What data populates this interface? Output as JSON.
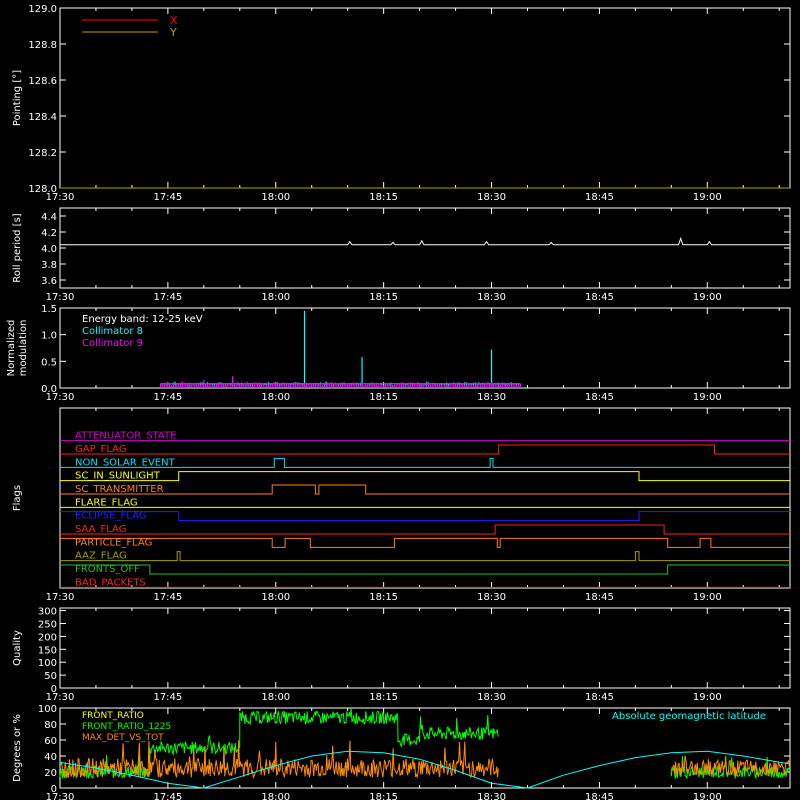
{
  "time_axis": {
    "tick_labels": [
      "17:30",
      "17:45",
      "18:00",
      "18:15",
      "18:30",
      "18:45",
      "19:00"
    ],
    "tick_minutes": [
      0,
      15,
      30,
      45,
      60,
      75,
      90
    ],
    "range_minutes": [
      0,
      101.5
    ]
  },
  "chart_data": [
    {
      "id": "pointing",
      "type": "line",
      "ylabel": "Pointing [°]",
      "ylim": [
        128.0,
        129.0
      ],
      "y_ticks": [
        "128.0",
        "128.2",
        "128.4",
        "128.6",
        "128.8",
        "129.0"
      ],
      "y_tick_values": [
        128.0,
        128.2,
        128.4,
        128.6,
        128.8,
        129.0
      ],
      "legend": [
        {
          "name": "X",
          "color": "#ff0000"
        },
        {
          "name": "Y",
          "color": "#b8a000"
        }
      ],
      "series": [
        {
          "name": "X",
          "color": "#ff0000",
          "x": [
            0,
            101.5
          ],
          "y": [
            128.0,
            128.0
          ]
        },
        {
          "name": "Y",
          "color": "#b8a000",
          "x": [
            0,
            101.5
          ],
          "y": [
            128.0,
            128.0
          ]
        }
      ]
    },
    {
      "id": "roll",
      "type": "line",
      "ylabel": "Roll period [s]",
      "ylim": [
        3.5,
        4.5
      ],
      "y_ticks": [
        "3.6",
        "3.8",
        "4.0",
        "4.2",
        "4.4"
      ],
      "y_tick_values": [
        3.6,
        3.8,
        4.0,
        4.2,
        4.4
      ],
      "series": [
        {
          "name": "",
          "color": "#ffffff",
          "x": [
            0,
            40,
            40.3,
            40.6,
            46,
            46.3,
            46.6,
            50,
            50.3,
            50.6,
            59,
            59.3,
            59.6,
            68,
            68.3,
            68.6,
            86,
            86.3,
            86.6,
            90,
            90.3,
            90.6,
            101.5
          ],
          "y": [
            4.04,
            4.04,
            4.08,
            4.04,
            4.04,
            4.07,
            4.04,
            4.04,
            4.09,
            4.04,
            4.04,
            4.08,
            4.04,
            4.04,
            4.07,
            4.04,
            4.04,
            4.12,
            4.04,
            4.04,
            4.08,
            4.04,
            4.04
          ]
        }
      ]
    },
    {
      "id": "modulation",
      "type": "line",
      "ylabel": "Normalized modulation",
      "ylim": [
        0,
        1.5
      ],
      "y_ticks": [
        "0.0",
        "0.5",
        "1.0",
        "1.5"
      ],
      "y_tick_values": [
        0,
        0.5,
        1.0,
        1.5
      ],
      "annotation": "Energy band: 12-25 keV",
      "legend": [
        {
          "name": "Collimator 8",
          "color": "#00ffff"
        },
        {
          "name": "Collimator 9",
          "color": "#ff00ff"
        }
      ],
      "series": [
        {
          "name": "Collimator 8",
          "color": "#00ffff",
          "x": [
            14,
            16,
            18,
            22,
            26,
            28,
            32,
            34,
            36,
            37,
            38,
            42,
            46,
            50,
            51,
            52,
            54,
            58,
            60,
            61,
            62,
            64
          ],
          "y": [
            0.08,
            0.12,
            0.08,
            0.1,
            0.09,
            0.08,
            0.07,
            1.45,
            0.08,
            0.12,
            0.08,
            0.58,
            0.1,
            0.08,
            0.12,
            0.09,
            0.08,
            0.08,
            0.72,
            0.1,
            0.08,
            0.07
          ]
        },
        {
          "name": "Collimator 9",
          "color": "#ff00ff",
          "x": [
            14,
            17,
            20,
            22,
            24,
            26,
            30,
            34,
            40,
            44,
            50,
            56,
            60,
            64
          ],
          "y": [
            0.08,
            0.12,
            0.15,
            0.1,
            0.22,
            0.12,
            0.1,
            0.09,
            0.08,
            0.1,
            0.08,
            0.09,
            0.1,
            0.08
          ]
        }
      ]
    },
    {
      "id": "flags",
      "type": "line",
      "ylabel": "Flags",
      "flags": [
        {
          "name": "ATTENUATOR_STATE",
          "color": "#d000d0",
          "steps": [
            [
              0,
              0
            ],
            [
              101.5,
              0
            ]
          ]
        },
        {
          "name": "GAP_FLAG",
          "color": "#ff2020",
          "steps": [
            [
              0,
              0
            ],
            [
              61,
              1
            ],
            [
              91,
              0
            ],
            [
              101.5,
              0
            ]
          ]
        },
        {
          "name": "NON_SOLAR_EVENT",
          "color": "#00e0ff",
          "steps": [
            [
              0,
              0
            ],
            [
              29.8,
              1
            ],
            [
              31.2,
              0
            ],
            [
              59.8,
              1
            ],
            [
              60.2,
              0
            ],
            [
              101.5,
              0
            ]
          ]
        },
        {
          "name": "SC_IN_SUNLIGHT",
          "color": "#ffff00",
          "steps": [
            [
              0,
              0
            ],
            [
              16.5,
              1
            ],
            [
              80.5,
              0
            ],
            [
              101.5,
              0
            ]
          ]
        },
        {
          "name": "SC_TRANSMITTER",
          "color": "#ff7f1f",
          "steps": [
            [
              0,
              0
            ],
            [
              29.5,
              1
            ],
            [
              35.5,
              0
            ],
            [
              36,
              1
            ],
            [
              42.5,
              0
            ],
            [
              101.5,
              0
            ]
          ]
        },
        {
          "name": "FLARE_FLAG",
          "color": "#ffff00",
          "steps": [
            [
              0,
              0
            ],
            [
              101.5,
              0
            ]
          ]
        },
        {
          "name": "ECLIPSE_FLAG",
          "color": "#2020ff",
          "steps": [
            [
              0,
              1
            ],
            [
              16.5,
              0
            ],
            [
              80.5,
              1
            ],
            [
              101.5,
              1
            ]
          ]
        },
        {
          "name": "SAA_FLAG",
          "color": "#ff2020",
          "steps": [
            [
              0,
              0
            ],
            [
              60.5,
              1
            ],
            [
              84,
              0
            ],
            [
              101.5,
              0
            ]
          ]
        },
        {
          "name": "PARTICLE_FLAG",
          "color": "#ff7f1f",
          "steps": [
            [
              0,
              1
            ],
            [
              29.5,
              0
            ],
            [
              31.3,
              1
            ],
            [
              34.8,
              0
            ],
            [
              46.5,
              1
            ],
            [
              60.8,
              0
            ],
            [
              61.2,
              1
            ],
            [
              84.5,
              0
            ],
            [
              89,
              1
            ],
            [
              90.5,
              0
            ],
            [
              101.5,
              0
            ]
          ]
        },
        {
          "name": "AAZ_FLAG",
          "color": "#a0a000",
          "steps": [
            [
              0,
              0
            ],
            [
              16.3,
              1
            ],
            [
              16.7,
              0
            ],
            [
              80,
              1
            ],
            [
              80.5,
              0
            ],
            [
              101.5,
              0
            ]
          ]
        },
        {
          "name": "FRONTS_OFF",
          "color": "#20c020",
          "steps": [
            [
              0,
              1
            ],
            [
              12.5,
              0
            ],
            [
              84.5,
              1
            ],
            [
              101.5,
              1
            ]
          ]
        },
        {
          "name": "BAD_PACKETS",
          "color": "#ff2020",
          "steps": [
            [
              0,
              0
            ],
            [
              101.5,
              0
            ]
          ]
        }
      ]
    },
    {
      "id": "quality",
      "type": "line",
      "ylabel": "Quality",
      "ylim": [
        0,
        310
      ],
      "y_ticks": [
        "0",
        "50",
        "100",
        "150",
        "200",
        "250",
        "300"
      ],
      "y_tick_values": [
        0,
        50,
        100,
        150,
        200,
        250,
        300
      ]
    },
    {
      "id": "front",
      "type": "line",
      "ylabel": "Degrees or %",
      "ylim": [
        0,
        100
      ],
      "y_ticks": [
        "0",
        "20",
        "40",
        "60",
        "80",
        "100"
      ],
      "y_tick_values": [
        0,
        20,
        40,
        60,
        80,
        100
      ],
      "legend": [
        {
          "name": "FRONT_RATIO",
          "color": "#ffff00"
        },
        {
          "name": "FRONT_RATIO_1225",
          "color": "#00ff00"
        },
        {
          "name": "MAX_DET_VS_TOT",
          "color": "#ff8c00"
        }
      ],
      "legend_right": {
        "name": "Absolute geomagnetic latitude",
        "color": "#00ffff"
      },
      "series": [
        {
          "name": "FRONT_RATIO_1225",
          "color": "#00ff00",
          "noise": 8,
          "x": [
            0,
            12.5,
            12.5,
            25,
            25,
            47,
            47,
            50,
            50,
            61,
            61
          ],
          "y": [
            20,
            20,
            50,
            50,
            88,
            88,
            60,
            60,
            68,
            68,
            null
          ]
        },
        {
          "name": "FRONT_RATIO_1225",
          "color": "#00ff00",
          "noise": 8,
          "x": [
            85,
            85,
            101.5
          ],
          "y": [
            20,
            20,
            20
          ]
        },
        {
          "name": "MAX_DET_VS_TOT",
          "color": "#ff8c00",
          "noise": 12,
          "x": [
            0,
            61
          ],
          "y": [
            25,
            25
          ]
        },
        {
          "name": "MAX_DET_VS_TOT",
          "color": "#ff8c00",
          "noise": 10,
          "x": [
            85,
            101.5
          ],
          "y": [
            25,
            25
          ]
        },
        {
          "name": "Absolute geomagnetic latitude",
          "color": "#00ffff",
          "x": [
            0,
            5,
            10,
            15,
            20,
            25,
            30,
            35,
            40,
            45,
            50,
            55,
            60,
            65,
            70,
            75,
            80,
            85,
            90,
            95,
            101.5
          ],
          "y": [
            32,
            25,
            16,
            6,
            0,
            14,
            28,
            40,
            46,
            44,
            36,
            22,
            6,
            0,
            16,
            28,
            38,
            44,
            46,
            40,
            30
          ]
        }
      ]
    }
  ]
}
